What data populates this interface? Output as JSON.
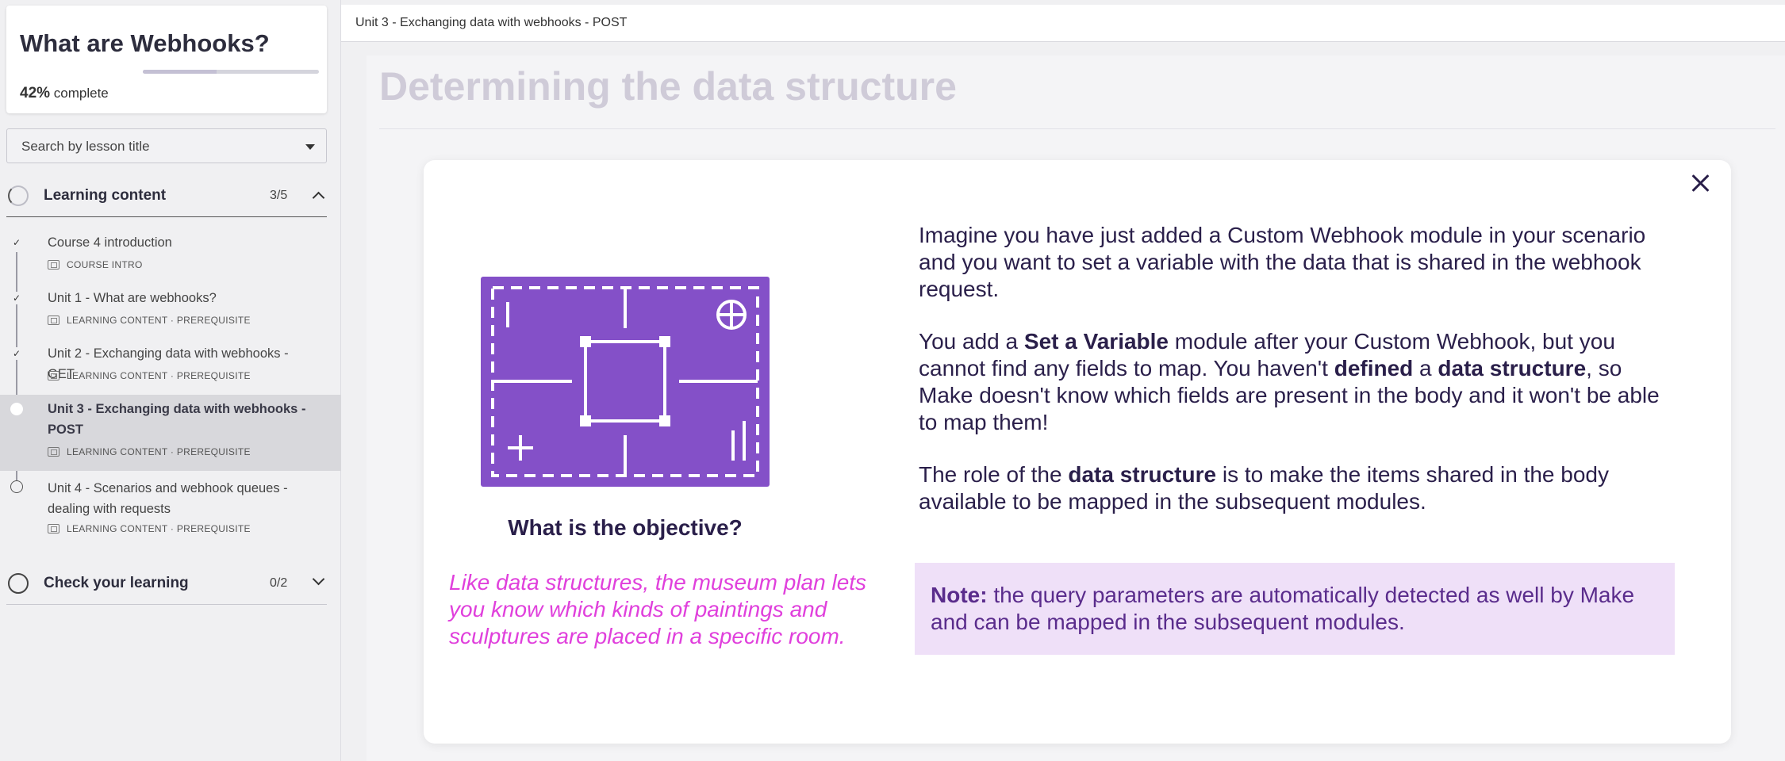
{
  "sidebar": {
    "course_title": "What are Webhooks?",
    "progress_percent": "42%",
    "progress_suffix": "complete",
    "progress_value": 0.42,
    "search_placeholder": "Search by lesson title",
    "sections": [
      {
        "title": "Learning content",
        "count": "3/5",
        "expanded": true,
        "lessons": [
          {
            "title": "Course 4 introduction",
            "meta": "COURSE INTRO",
            "status": "completed"
          },
          {
            "title": "Unit 1 - What are webhooks?",
            "meta": "LEARNING CONTENT · PREREQUISITE",
            "status": "completed"
          },
          {
            "title": "Unit 2 - Exchanging data with webhooks - GET",
            "meta": "LEARNING CONTENT · PREREQUISITE",
            "status": "completed"
          },
          {
            "title": "Unit 3 - Exchanging data with webhooks - POST",
            "meta": "LEARNING CONTENT · PREREQUISITE",
            "status": "current"
          },
          {
            "title": "Unit 4 - Scenarios and webhook queues - dealing with requests",
            "meta": "LEARNING CONTENT · PREREQUISITE",
            "status": "not-started"
          }
        ]
      },
      {
        "title": "Check your learning",
        "count": "0/2",
        "expanded": false
      }
    ],
    "check_mark": "✓"
  },
  "header": {
    "breadcrumb": "Unit 3 - Exchanging data with webhooks - POST"
  },
  "page": {
    "title": "Determining the data structure"
  },
  "modal": {
    "objective_label": "What is the objective?",
    "quote": "Like data structures, the museum plan lets you know which kinds of paintings and sculptures are placed in a specific room.",
    "p1": "Imagine you have just added a Custom Webhook module in your scenario and you want to set a variable with the data that is shared in the webhook request.",
    "p2_a": "You add a ",
    "p2_b": "Set a Variable",
    "p2_c": " module after your Custom Webhook, but you cannot find any fields to map. You haven't ",
    "p2_d": "defined",
    "p2_e": " a ",
    "p2_f": "data structure",
    "p2_g": ", so Make doesn't know which fields are present in the body and it won't be able to map them!",
    "p3_a": "The role of the ",
    "p3_b": "data structure",
    "p3_c": " is to make the items shared in the body available to be mapped in the subsequent modules.",
    "note_label": "Note:",
    "note_text": " the query parameters are automatically detected as well by Make and can be mapped in the subsequent modules."
  },
  "colors": {
    "illustration_purple": "#8450c8",
    "quote_pink": "#e040dc",
    "note_bg": "#efe0f8",
    "note_text": "#5a2c8c",
    "text_dark": "#2a1f4a"
  },
  "icons": {
    "close": "close-icon",
    "dropdown": "chevron-down-icon",
    "lesson_meta": "lesson-type-icon"
  }
}
